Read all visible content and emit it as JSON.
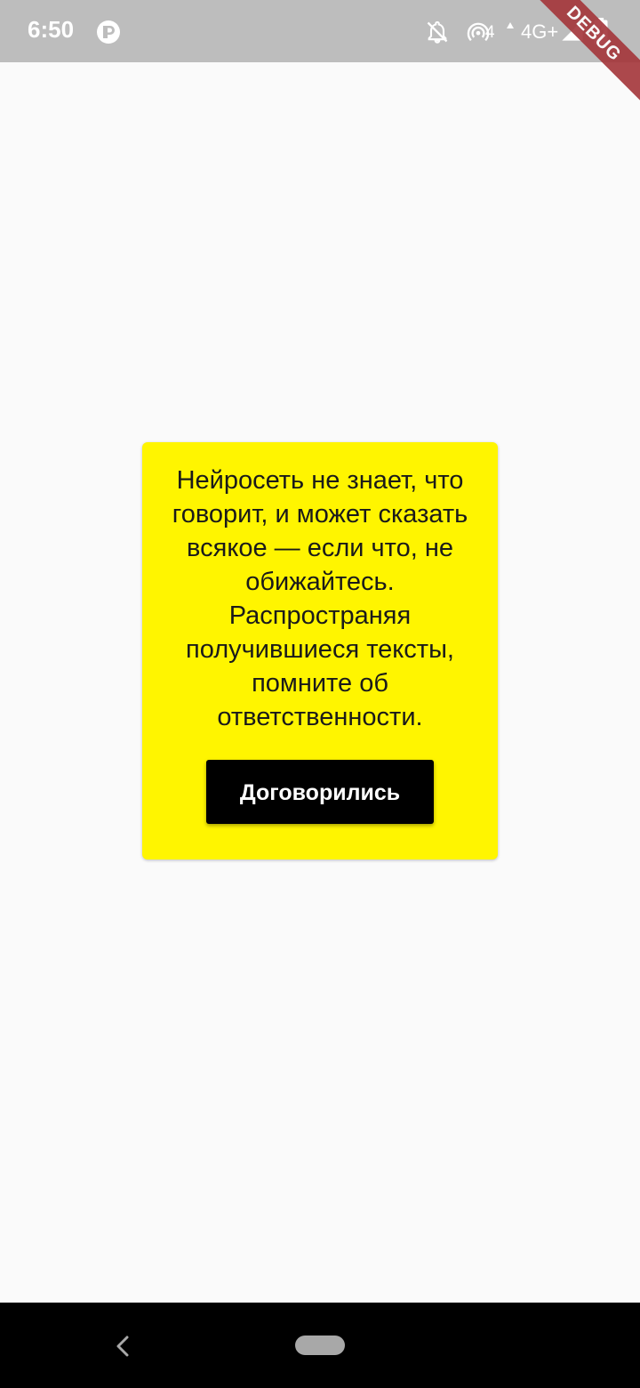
{
  "status_bar": {
    "time": "6:50",
    "hotspot_count": "4",
    "network": "4G+",
    "debug_banner": "DEBUG",
    "icons": [
      "app-p-icon",
      "notifications-off-icon",
      "hotspot-icon",
      "signal-icon",
      "battery-charging-icon"
    ]
  },
  "dialog": {
    "message": "Нейросеть не знает, что говорит, и может сказать всякое — если что, не обижайтесь. Распространяя получившиеся тексты, помните об ответственности.",
    "button_label": "Договорились",
    "background_color": "#fff500",
    "button_color": "#000000"
  },
  "nav_bar": {
    "icons": [
      "back-icon",
      "home-pill"
    ]
  }
}
